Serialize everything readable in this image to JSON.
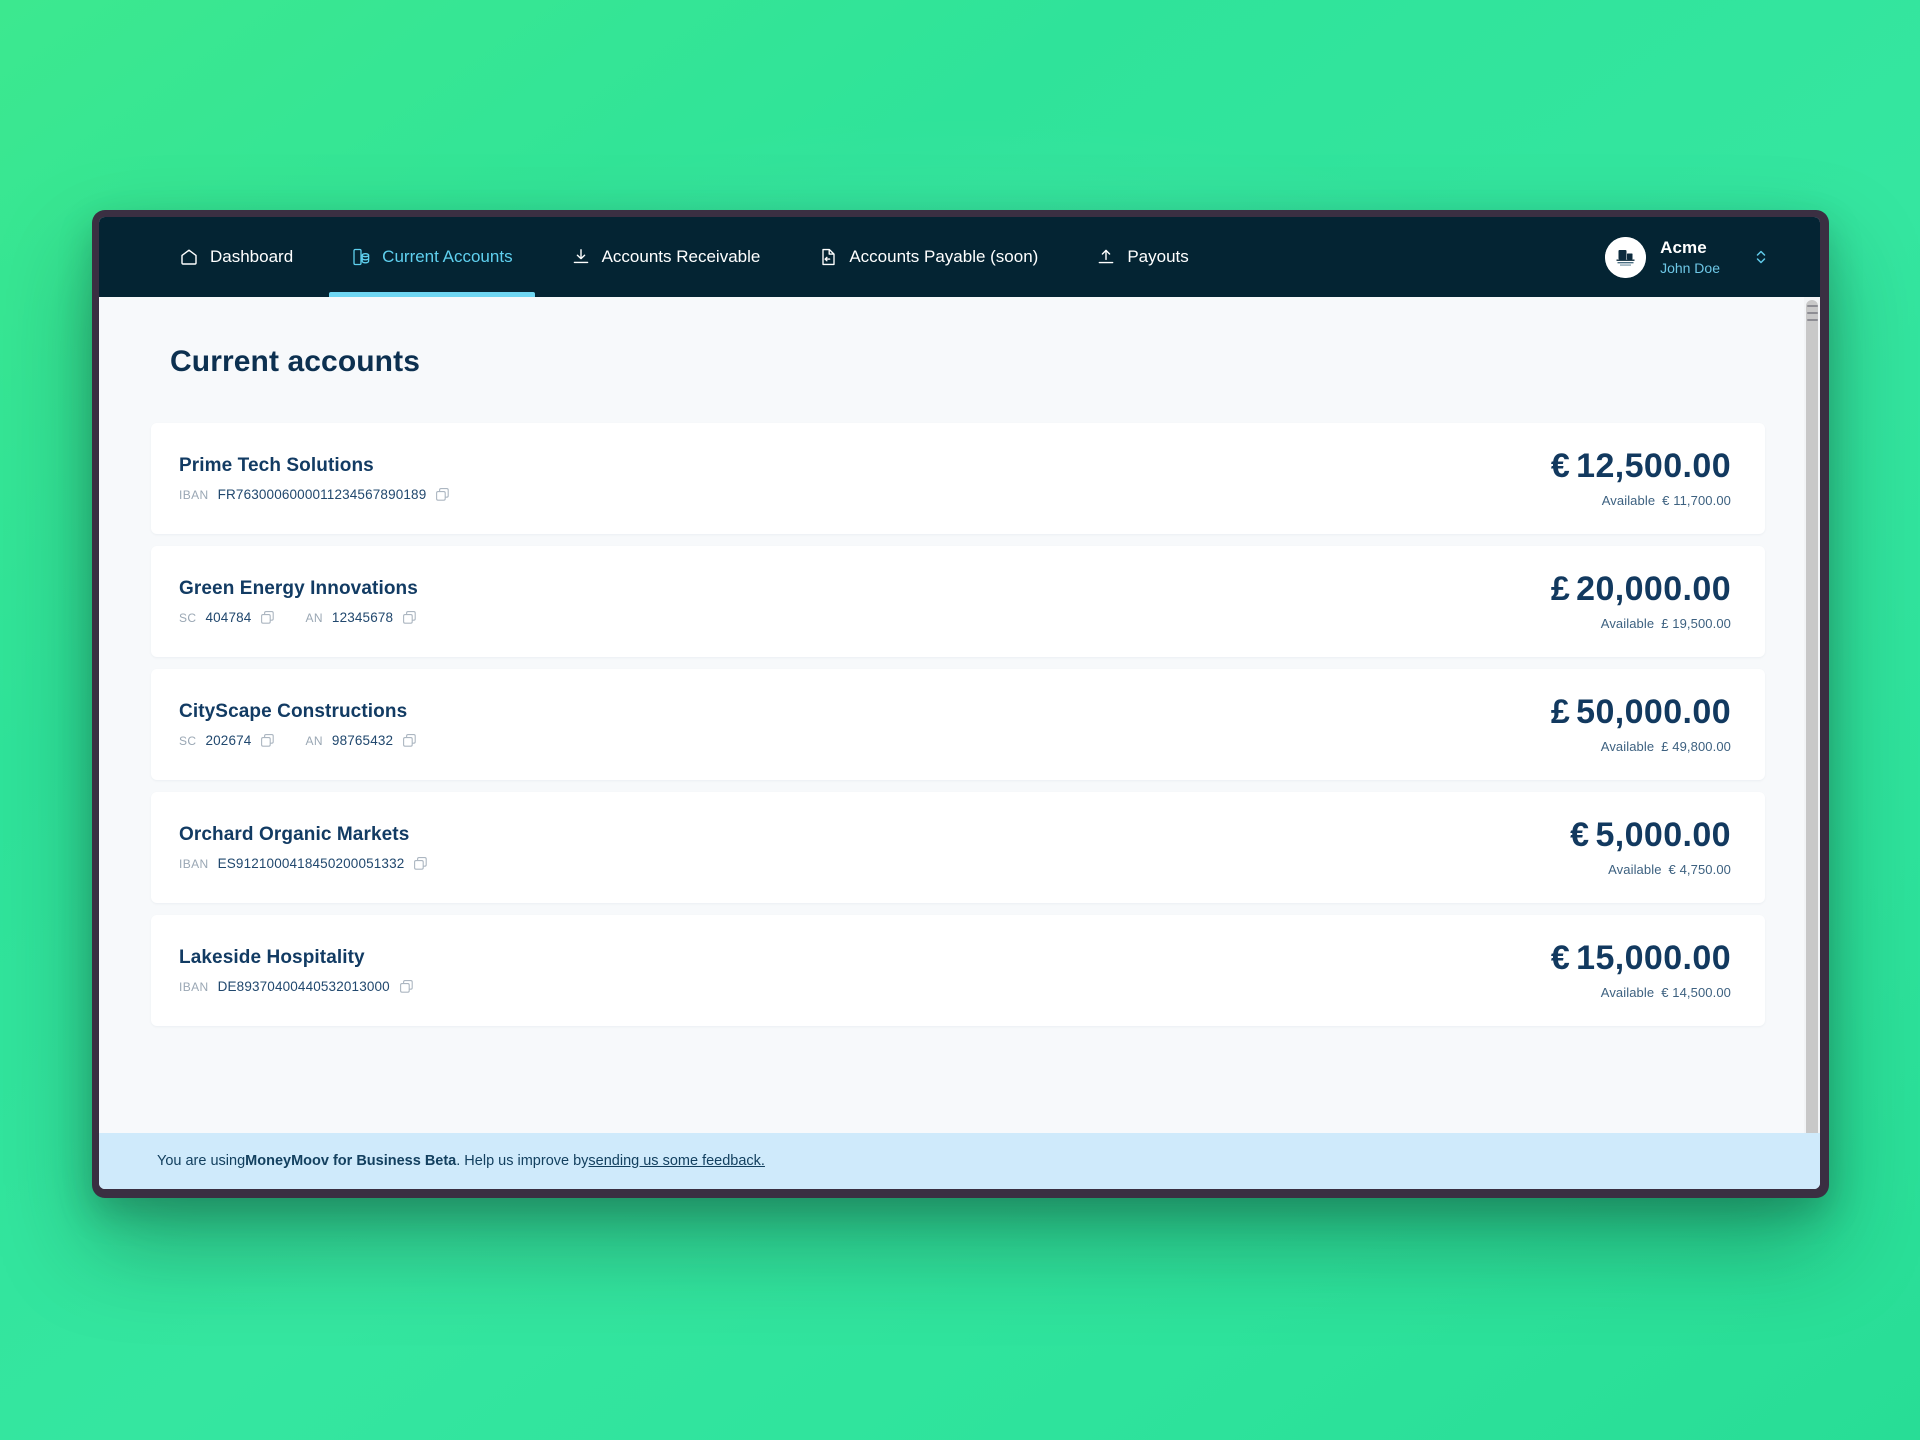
{
  "nav": {
    "items": [
      {
        "label": "Dashboard",
        "icon": "home-icon",
        "active": false
      },
      {
        "label": "Current Accounts",
        "icon": "accounts-icon",
        "active": true
      },
      {
        "label": "Accounts Receivable",
        "icon": "download-icon",
        "active": false
      },
      {
        "label": "Accounts Payable (soon)",
        "icon": "document-icon",
        "active": false
      },
      {
        "label": "Payouts",
        "icon": "upload-icon",
        "active": false
      }
    ]
  },
  "profile": {
    "org": "Acme",
    "user": "John Doe",
    "avatar_icon": "company-logo-icon",
    "caret_icon": "chevron-updown-icon"
  },
  "page": {
    "title": "Current accounts"
  },
  "accounts": [
    {
      "name": "Prime Tech Solutions",
      "identifiers": [
        {
          "label": "IBAN",
          "value": "FR7630006000011234567890189"
        }
      ],
      "balance_currency": "€",
      "balance": "12,500.00",
      "available_label": "Available",
      "available_currency": "€",
      "available": "11,700.00"
    },
    {
      "name": "Green Energy Innovations",
      "identifiers": [
        {
          "label": "SC",
          "value": "404784"
        },
        {
          "label": "AN",
          "value": "12345678"
        }
      ],
      "balance_currency": "£",
      "balance": "20,000.00",
      "available_label": "Available",
      "available_currency": "£",
      "available": "19,500.00"
    },
    {
      "name": "CityScape Constructions",
      "identifiers": [
        {
          "label": "SC",
          "value": "202674"
        },
        {
          "label": "AN",
          "value": "98765432"
        }
      ],
      "balance_currency": "£",
      "balance": "50,000.00",
      "available_label": "Available",
      "available_currency": "£",
      "available": "49,800.00"
    },
    {
      "name": "Orchard Organic Markets",
      "identifiers": [
        {
          "label": "IBAN",
          "value": "ES9121000418450200051332"
        }
      ],
      "balance_currency": "€",
      "balance": "5,000.00",
      "available_label": "Available",
      "available_currency": "€",
      "available": "4,750.00"
    },
    {
      "name": "Lakeside Hospitality",
      "identifiers": [
        {
          "label": "IBAN",
          "value": "DE89370400440532013000"
        }
      ],
      "balance_currency": "€",
      "balance": "15,000.00",
      "available_label": "Available",
      "available_currency": "€",
      "available": "14,500.00"
    }
  ],
  "footer": {
    "text_before": "You are using ",
    "product": "MoneyMoov for Business Beta",
    "text_middle": ". Help us improve by ",
    "link": "sending us some feedback."
  },
  "colors": {
    "nav_bg": "#042433",
    "accent": "#6fd6f2",
    "heading": "#0c3050",
    "card_bg": "#ffffff",
    "page_bg": "#f7f9fb",
    "banner_bg": "#cfeafb",
    "backdrop": "#31e39a"
  }
}
